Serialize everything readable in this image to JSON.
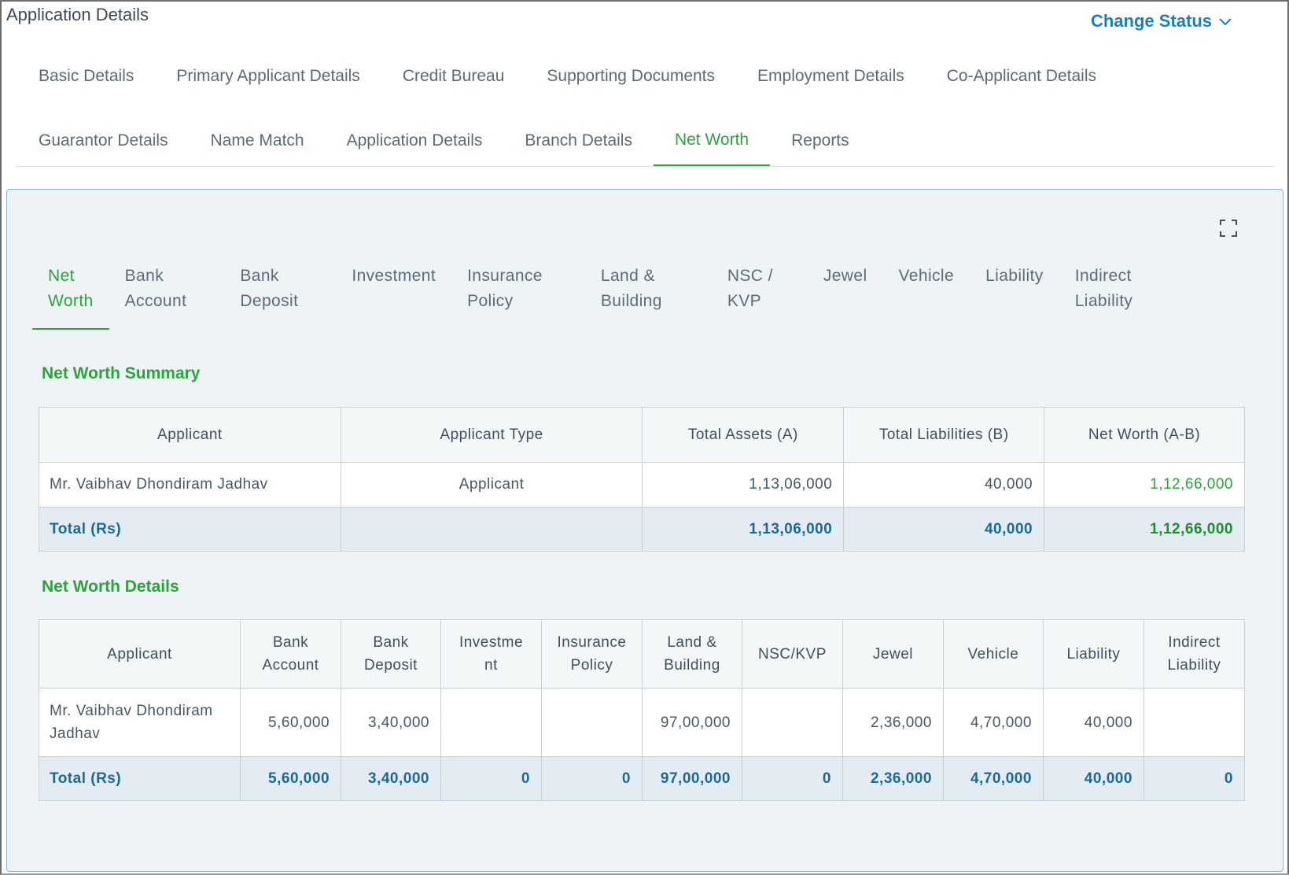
{
  "header": {
    "title": "Application Details",
    "change_status_label": "Change Status"
  },
  "main_tabs": {
    "row1": [
      "Basic Details",
      "Primary Applicant Details",
      "Credit Bureau",
      "Supporting Documents",
      "Employment Details",
      "Co-Applicant Details"
    ],
    "row2": [
      "Guarantor Details",
      "Name Match",
      "Application Details",
      "Branch Details",
      "Net Worth",
      "Reports"
    ],
    "active": "Net Worth"
  },
  "sub_tabs": {
    "items": [
      "Net\nWorth",
      "Bank\nAccount",
      "Bank\nDeposit",
      "Investment",
      "Insurance\nPolicy",
      "Land &\nBuilding",
      "NSC /\nKVP",
      "Jewel",
      "Vehicle",
      "Liability",
      "Indirect\nLiability"
    ],
    "active_index": 0
  },
  "summary": {
    "title": "Net Worth Summary",
    "headers": [
      "Applicant",
      "Applicant Type",
      "Total Assets (A)",
      "Total Liabilities (B)",
      "Net Worth (A-B)"
    ],
    "row": {
      "applicant": "Mr. Vaibhav Dhondiram Jadhav",
      "applicant_type": "Applicant",
      "total_assets": "1,13,06,000",
      "total_liabilities": "40,000",
      "net_worth": "1,12,66,000"
    },
    "total": {
      "label": "Total (Rs)",
      "total_assets": "1,13,06,000",
      "total_liabilities": "40,000",
      "net_worth": "1,12,66,000"
    }
  },
  "details": {
    "title": "Net Worth Details",
    "headers": [
      "Applicant",
      "Bank\nAccount",
      "Bank\nDeposit",
      "Investme\nnt",
      "Insurance\nPolicy",
      "Land &\nBuilding",
      "NSC/KVP",
      "Jewel",
      "Vehicle",
      "Liability",
      "Indirect\nLiability"
    ],
    "row": [
      "Mr. Vaibhav Dhondiram Jadhav",
      "5,60,000",
      "3,40,000",
      "",
      "",
      "97,00,000",
      "",
      "2,36,000",
      "4,70,000",
      "40,000",
      ""
    ],
    "total": [
      "Total (Rs)",
      "5,60,000",
      "3,40,000",
      "0",
      "0",
      "97,00,000",
      "0",
      "2,36,000",
      "4,70,000",
      "40,000",
      "0"
    ]
  },
  "colors": {
    "accent_green": "#2aa43b",
    "link_blue": "#1b7fc1",
    "total_blue": "#1b6a94",
    "panel_bg": "#eef4f6"
  },
  "icons": {
    "change_status": "chevron-down-icon",
    "panel": "expand-icon"
  }
}
